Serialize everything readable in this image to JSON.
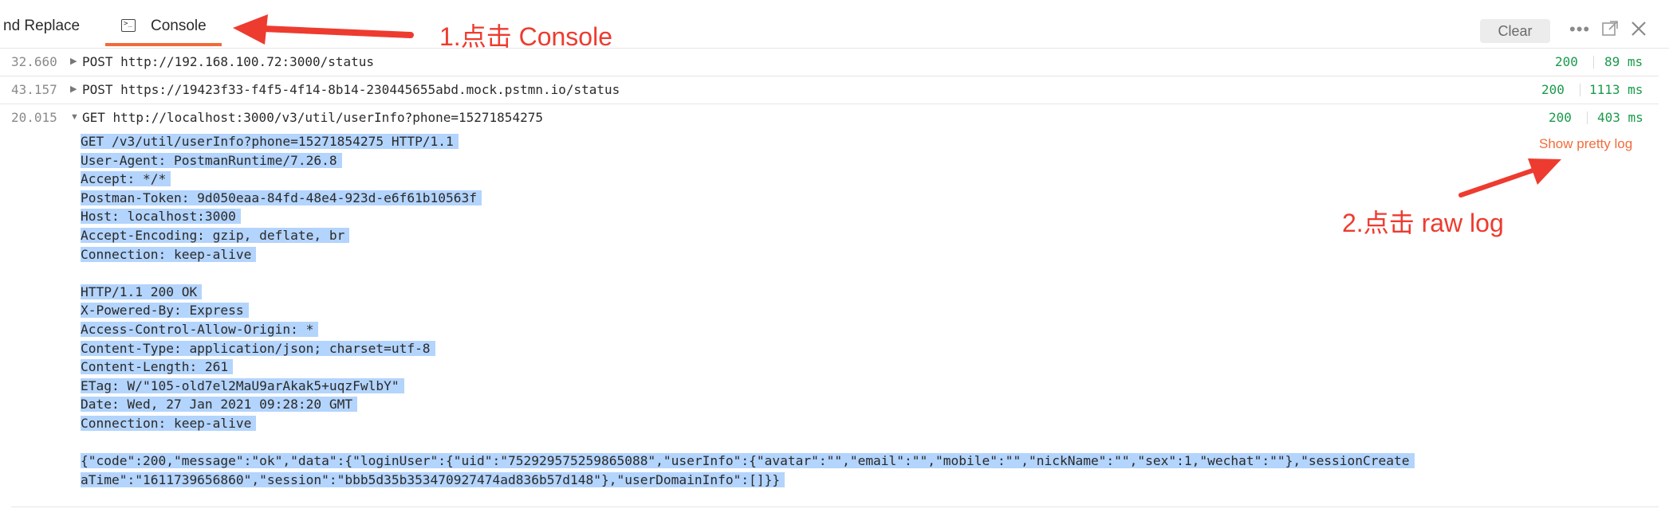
{
  "tabs": {
    "find_replace": "nd Replace",
    "console": "Console"
  },
  "toolbar": {
    "clear_label": "Clear",
    "more_icon": "more-horizontal-icon",
    "popout_icon": "popout-icon",
    "close_icon": "close-icon"
  },
  "rows": [
    {
      "time": "32.660",
      "method_url": "POST http://192.168.100.72:3000/status",
      "status": "200",
      "duration": "89 ms",
      "expanded": false
    },
    {
      "time": "43.157",
      "method_url": "POST https://19423f33-f4f5-4f14-8b14-230445655abd.mock.pstmn.io/status",
      "status": "200",
      "duration": "1113 ms",
      "expanded": false
    },
    {
      "time": "20.015",
      "method_url": "GET http://localhost:3000/v3/util/userInfo?phone=15271854275",
      "status": "200",
      "duration": "403 ms",
      "expanded": true
    }
  ],
  "show_pretty_label": "Show pretty log",
  "raw_log": {
    "request": [
      "GET /v3/util/userInfo?phone=15271854275 HTTP/1.1",
      "User-Agent: PostmanRuntime/7.26.8",
      "Accept: */*",
      "Postman-Token: 9d050eaa-84fd-48e4-923d-e6f61b10563f",
      "Host: localhost:3000",
      "Accept-Encoding: gzip, deflate, br",
      "Connection: keep-alive"
    ],
    "response": [
      "HTTP/1.1 200 OK",
      "X-Powered-By: Express",
      "Access-Control-Allow-Origin: *",
      "Content-Type: application/json; charset=utf-8",
      "Content-Length: 261",
      "ETag: W/\"105-old7el2MaU9arAkak5+uqzFwlbY\"",
      "Date: Wed, 27 Jan 2021 09:28:20 GMT",
      "Connection: keep-alive"
    ],
    "body": [
      "{\"code\":200,\"message\":\"ok\",\"data\":{\"loginUser\":{\"uid\":\"752929575259865088\",\"userInfo\":{\"avatar\":\"\",\"email\":\"\",\"mobile\":\"\",\"nickName\":\"\",\"sex\":1,\"wechat\":\"\"},\"sessionCreate",
      "aTime\":\"1611739656860\",\"session\":\"bbb5d35b353470927474ad836b57d148\"},\"userDomainInfo\":[]}}"
    ]
  },
  "annotations": {
    "step1": "1.点击 Console",
    "step2": "2.点击 raw log"
  },
  "colors": {
    "accent": "#f26b3a",
    "status_ok": "#1a9a4b",
    "selection": "#b3d4fc",
    "annotation": "#ee3b2f"
  }
}
